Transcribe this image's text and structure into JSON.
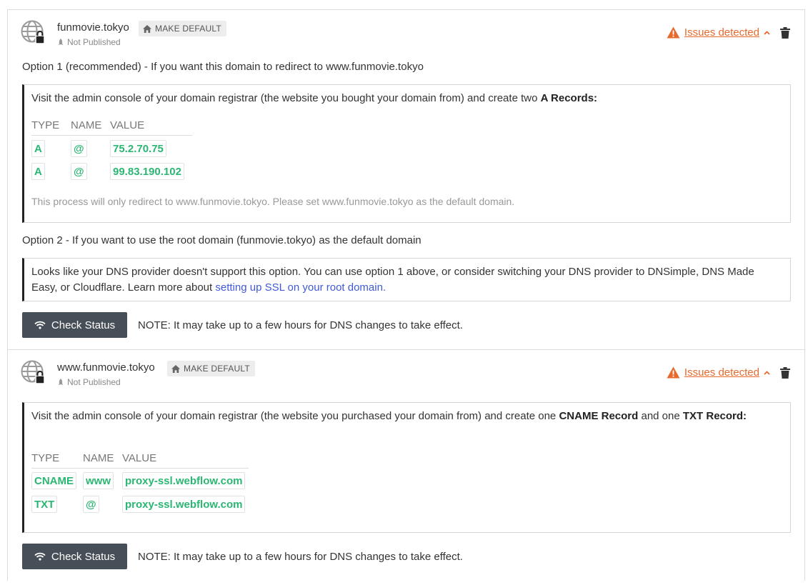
{
  "domains": [
    {
      "name": "funmovie.tokyo",
      "make_default": "MAKE DEFAULT",
      "status": "Not Published",
      "issues": "Issues detected",
      "option1_title": "Option 1 (recommended) - If you want this domain to redirect to www.funmovie.tokyo",
      "option1_intro": "Visit the admin console of your domain registrar (the website you bought your domain from) and create two ",
      "option1_intro_bold": "A Records:",
      "table_headers": [
        "TYPE",
        "NAME",
        "VALUE"
      ],
      "records": [
        {
          "type": "A",
          "name": "@",
          "value": "75.2.70.75"
        },
        {
          "type": "A",
          "name": "@",
          "value": "99.83.190.102"
        }
      ],
      "option1_note": "This process will only redirect to www.funmovie.tokyo. Please set www.funmovie.tokyo as the default domain.",
      "option2_title": "Option 2 - If you want to use the root domain (funmovie.tokyo) as the default domain",
      "option2_text": "Looks like your DNS provider doesn't support this option. You can use option 1 above, or consider switching your DNS provider to DNSimple, DNS Made Easy, or Cloudflare. Learn more about ",
      "option2_link": "setting up SSL on your root domain.",
      "check_button": "Check Status",
      "dns_note": "NOTE: It may take up to a few hours for DNS changes to take effect."
    },
    {
      "name": "www.funmovie.tokyo",
      "make_default": "MAKE DEFAULT",
      "status": "Not Published",
      "issues": "Issues detected",
      "intro_a": "Visit the admin console of your domain registrar (the website you purchased your domain from) and create one ",
      "intro_bold1": "CNAME Record",
      "intro_b": " and one ",
      "intro_bold2": "TXT Record:",
      "table_headers": [
        "TYPE",
        "NAME",
        "VALUE"
      ],
      "records": [
        {
          "type": "CNAME",
          "name": "www",
          "value": "proxy-ssl.webflow.com"
        },
        {
          "type": "TXT",
          "name": "@",
          "value": "proxy-ssl.webflow.com"
        }
      ],
      "check_button": "Check Status",
      "dns_note": "NOTE: It may take up to a few hours for DNS changes to take effect."
    }
  ],
  "icons": {
    "globe": "globe-lock-icon",
    "home": "home-icon",
    "status": "rocket-icon",
    "warning": "warning-icon",
    "chevron": "chevron-up-icon",
    "trash": "trash-icon",
    "wifi": "wifi-icon"
  },
  "colors": {
    "warning": "#e8692c",
    "record_value": "#2bb673",
    "link": "#3f59d9",
    "button_bg": "#464e57"
  }
}
